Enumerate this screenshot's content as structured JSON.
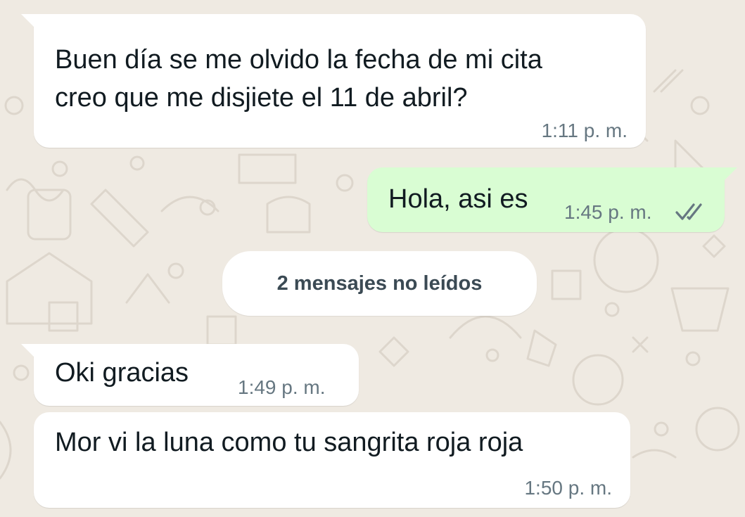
{
  "chat": {
    "messages": [
      {
        "direction": "incoming",
        "lines": [
          "Buen día se me olvido la fecha de mi cita",
          "creo que me disjiete el 11 de abril?"
        ],
        "time": "1:11 p. m."
      },
      {
        "direction": "outgoing",
        "text": "Hola, asi es",
        "time": "1:45 p. m.",
        "status": "read"
      },
      {
        "direction": "incoming",
        "text": "Oki gracias",
        "time": "1:49 p. m."
      },
      {
        "direction": "incoming",
        "text": "Mor vi la luna como tu sangrita roja roja",
        "time": "1:50 p. m."
      }
    ],
    "unread_divider": "2 mensajes no leídos"
  },
  "colors": {
    "wallpaper": "#efeae2",
    "incoming_bubble": "#ffffff",
    "outgoing_bubble": "#d9fdd3",
    "time_text": "#667781",
    "read_ticks": "#667781"
  },
  "icons": {
    "status_ticks": "double-check-icon"
  }
}
